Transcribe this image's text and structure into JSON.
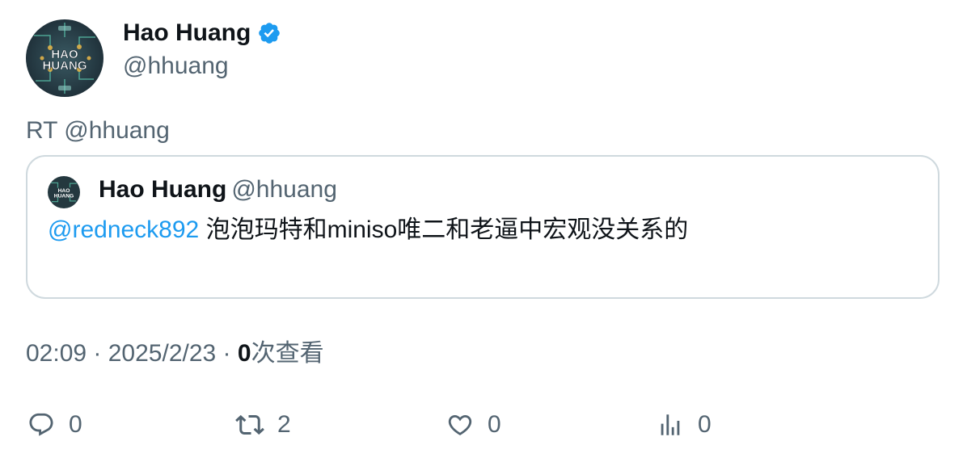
{
  "author": {
    "name": "Hao Huang",
    "handle": "@hhuang",
    "avatar_text_line1": "HAO",
    "avatar_text_line2": "HUANG",
    "verified_icon": "verified-badge-icon",
    "verified_color": "#1d9bf0"
  },
  "tweet": {
    "retweet_line": "RT @hhuang"
  },
  "quote": {
    "name": "Hao Huang",
    "handle": "@hhuang",
    "mention": "@redneck892",
    "text": " 泡泡玛特和miniso唯二和老逼中宏观没关系的"
  },
  "meta": {
    "time": "02:09",
    "separator": " · ",
    "date": "2025/2/23",
    "separator2": " · ",
    "views_count": "0",
    "views_label": "次查看"
  },
  "actions": {
    "reply_count": "0",
    "retweet_count": "2",
    "like_count": "0",
    "views_count": "0",
    "icons": [
      "reply-icon",
      "retweet-icon",
      "like-icon",
      "views-icon"
    ]
  },
  "colors": {
    "text": "#0f1419",
    "secondary": "#536471",
    "link": "#1d9bf0",
    "border": "#cfd9de"
  }
}
